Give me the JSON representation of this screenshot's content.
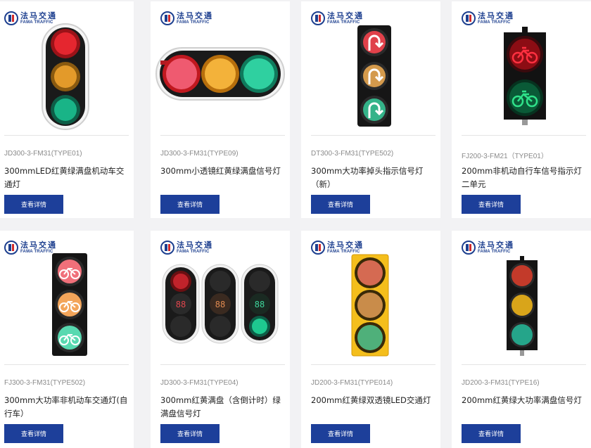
{
  "brand": {
    "name_cn": "法马交通",
    "name_en": "FAMA TRAFFIC"
  },
  "button_label": "查看详情",
  "products": [
    {
      "model": "JD300-3-FM31(TYPE01)",
      "title": "300mmLED红黄绿满盘机动车交通灯",
      "image": "three-round-full-ball-light"
    },
    {
      "model": "JD300-3-FM31(TYPE09)",
      "title": "300mm小透镜红黄绿满盘信号灯",
      "image": "horizontal-three-lens-light"
    },
    {
      "model": "DT300-3-FM31(TYPE502)",
      "title": "300mm大功率掉头指示信号灯（新）",
      "image": "u-turn-arrow-light"
    },
    {
      "model": "FJ200-3-FM21（TYPE01）",
      "title": "200mm非机动自行车信号指示灯二单元",
      "image": "bicycle-two-unit-light"
    },
    {
      "model": "FJ300-3-FM31(TYPE502)",
      "title": "300mm大功率非机动车交通灯(自行车）",
      "image": "bicycle-three-unit-light"
    },
    {
      "model": "JD300-3-FM31(TYPE04)",
      "title": "300mm红黄满盘（含倒计时）绿满盘信号灯",
      "image": "countdown-light-set"
    },
    {
      "model": "JD200-3-FM31(TYPE014)",
      "title": "200mm红黄绿双透镜LED交通灯",
      "image": "yellow-housing-light"
    },
    {
      "model": "JD200-3-FM31(TYPE16)",
      "title": "200mm红黄绿大功率满盘信号灯",
      "image": "black-compact-light"
    }
  ],
  "colors": {
    "button": "#1d3f9a",
    "brand": "#1d3f8f",
    "red": "#e5262f",
    "yellow": "#f0a028",
    "green": "#1ec98f"
  }
}
